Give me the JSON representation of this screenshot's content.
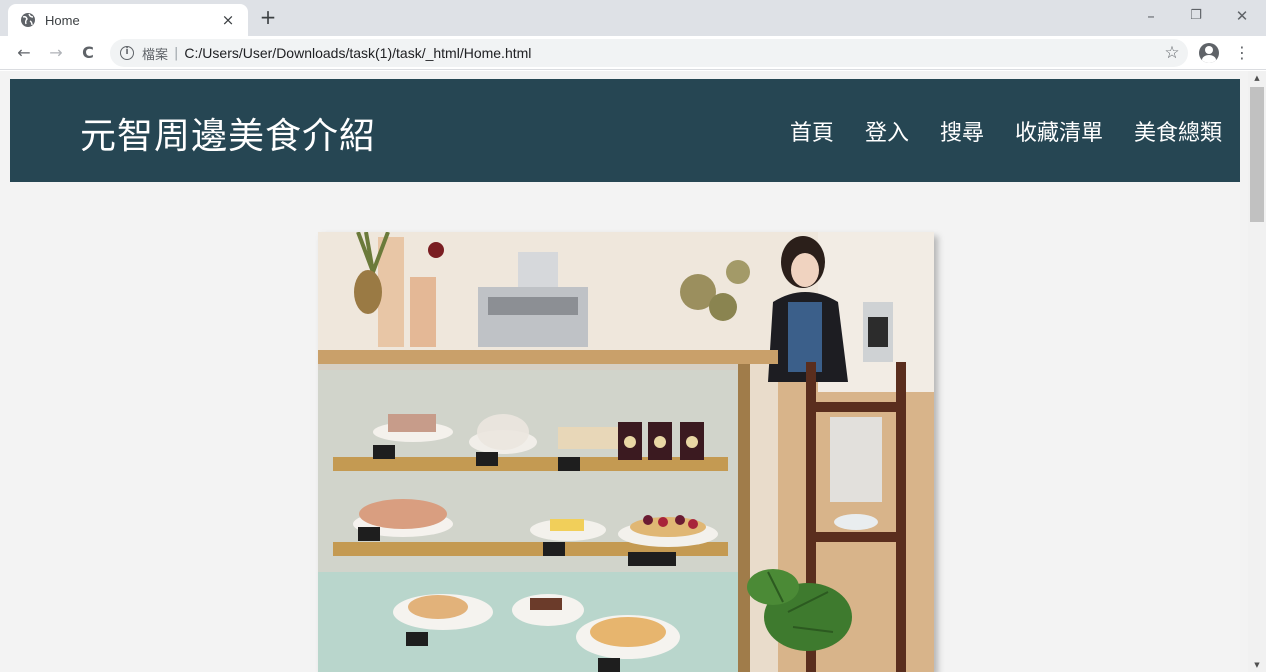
{
  "browser": {
    "tab_title": "Home",
    "tab_close": "×",
    "new_tab": "+",
    "window_controls": {
      "minimize": "–",
      "restore": "❐",
      "close": "✕"
    },
    "nav": {
      "back": "←",
      "forward": "→",
      "reload": "C"
    },
    "address": {
      "info_icon": "i",
      "scheme_label": "檔案",
      "separator": "|",
      "url": "C:/Users/User/Downloads/task(1)/task/_html/Home.html"
    },
    "bookmark_icon": "☆",
    "menu_icon": "⋮"
  },
  "page": {
    "site_title": "元智周邊美食介紹",
    "nav": [
      {
        "label": "首頁"
      },
      {
        "label": "登入"
      },
      {
        "label": "搜尋"
      },
      {
        "label": "收藏清單"
      },
      {
        "label": "美食總類"
      }
    ],
    "colors": {
      "header_bg": "#264653",
      "page_bg": "#f3f3f3"
    }
  }
}
